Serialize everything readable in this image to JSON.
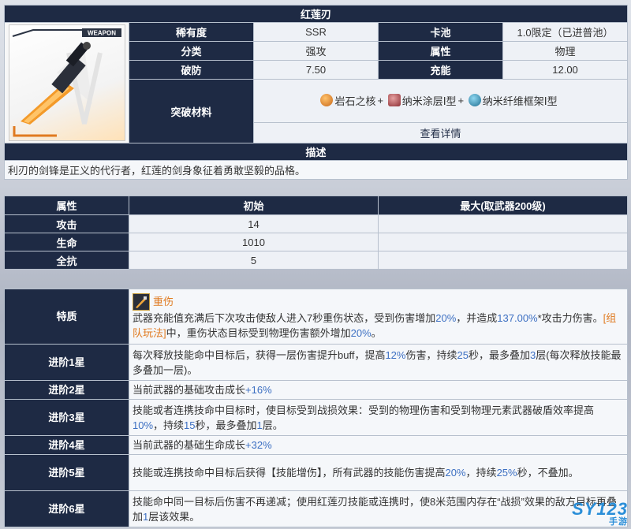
{
  "weapon": {
    "name": "红莲刃",
    "weapon_tag": "WEAPON",
    "rarity_label": "稀有度",
    "rarity_value": "SSR",
    "pool_label": "卡池",
    "pool_value": "1.0限定（已进普池）",
    "class_label": "分类",
    "class_value": "强攻",
    "attr_label": "属性",
    "attr_value": "物理",
    "break_label": "破防",
    "break_value": "7.50",
    "charge_label": "充能",
    "charge_value": "12.00",
    "materials_label": "突破材料",
    "materials": [
      {
        "name": "岩石之核",
        "suffix": "+",
        "icon": "rock-core-icon",
        "color": "#e08a2a"
      },
      {
        "name": "纳米涂层Ⅰ型",
        "suffix": "+",
        "icon": "nano-coating-icon",
        "color": "#b0464a"
      },
      {
        "name": "纳米纤维框架Ⅰ型",
        "suffix": "",
        "icon": "nano-fiber-frame-icon",
        "color": "#2f8fb7"
      }
    ],
    "details_link": "查看详情",
    "desc_header": "描述",
    "description": "利刃的剑锋是正义的代行者，红莲的剑身象征着勇敢坚毅的品格。"
  },
  "stats": {
    "headers": [
      "属性",
      "初始",
      "最大(取武器200级)"
    ],
    "rows": [
      {
        "name": "攻击",
        "init": "14",
        "max": ""
      },
      {
        "name": "生命",
        "init": "1010",
        "max": ""
      },
      {
        "name": "全抗",
        "init": "5",
        "max": ""
      }
    ]
  },
  "traits": {
    "trait_label": "特质",
    "trait_name": "重伤",
    "trait_text_1": "武器充能值充满后下次攻击使敌人进入7秒重伤状态，受到伤害增加",
    "trait_val_1": "20%",
    "trait_text_2": "，并造成",
    "trait_val_2": "137.00%",
    "trait_text_3": "*攻击力伤害。",
    "trait_tag": "[组队玩法]",
    "trait_text_4": "中，重伤状态目标受到物理伤害额外增加",
    "trait_val_3": "20%",
    "trait_text_5": "。",
    "star1_label": "进阶1星",
    "star1_a": "每次释放技能命中目标后，获得一层伤害提升buff，提高",
    "star1_v1": "12%",
    "star1_b": "伤害，持续",
    "star1_v2": "25",
    "star1_c": "秒，最多叠加",
    "star1_v3": "3",
    "star1_d": "层(每次释放技能最多叠加一层)。",
    "star2_label": "进阶2星",
    "star2_a": "当前武器的基础攻击成长",
    "star2_v": "+16%",
    "star3_label": "进阶3星",
    "star3_a": "技能或者连携技命中目标时，使目标受到战损效果：受到的物理伤害和受到物理元素武器破盾效率提高",
    "star3_v1": "10%",
    "star3_b": "，持续",
    "star3_v2": "15",
    "star3_c": "秒，最多叠加",
    "star3_v3": "1",
    "star3_d": "层。",
    "star4_label": "进阶4星",
    "star4_a": "当前武器的基础生命成长",
    "star4_v": "+32%",
    "star5_label": "进阶5星",
    "star5_a": "技能或连携技命中目标后获得【技能增伤】，所有武器的技能伤害提高",
    "star5_v1": "20%",
    "star5_b": "，持续",
    "star5_v2": "25%",
    "star5_c": "秒，不叠加。",
    "star6_label": "进阶6星",
    "star6_a": "技能命中同一目标后伤害不再递减；使用红莲刃技能或连携时，使8米范围内存在“战损”效果的敌方目标再叠加",
    "star6_v": "1",
    "star6_b": "层该效果。"
  },
  "watermark": {
    "main": "SY123",
    "sub": "手游"
  },
  "colors": {
    "header": "#1e2a44",
    "accent_blue": "#3c6fc2",
    "accent_orange": "#e07a20"
  }
}
